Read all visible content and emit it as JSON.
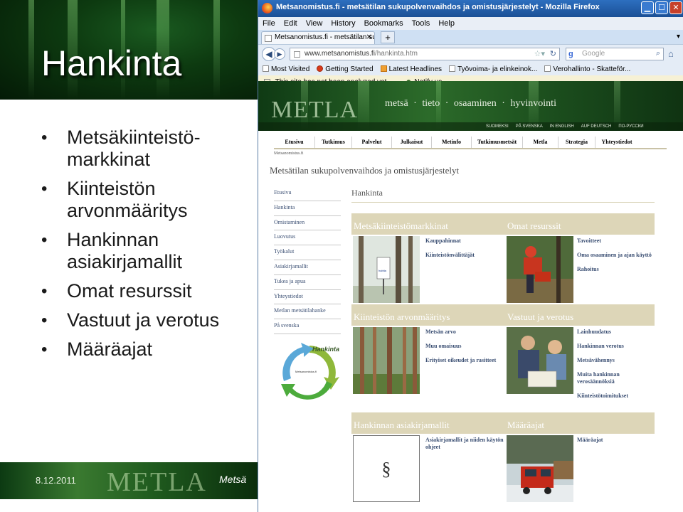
{
  "slide": {
    "title": "Hankinta",
    "bullets": [
      "Metsäkiinteistö-markkinat",
      "Kiinteistön arvonmääritys",
      "Hankinnan asiakirjamallit",
      "Omat resurssit",
      "Vastuut ja verotus",
      "Määräajat"
    ],
    "footer_date": "8.12.2011",
    "footer_logo": "METLA",
    "footer_word": "Metsä"
  },
  "browser": {
    "window_title": "Metsanomistus.fi - metsätilan sukupolvenvaihdos ja omistusjärjestelyt - Mozilla Firefox",
    "menu": [
      "File",
      "Edit",
      "View",
      "History",
      "Bookmarks",
      "Tools",
      "Help"
    ],
    "tab_title": "Metsanomistus.fi - metsätilan suku...",
    "url_host": "www.metsanomistus.fi",
    "url_path": "/hankinta.htm",
    "search_placeholder": "Google",
    "bookmarks": [
      "Most Visited",
      "Getting Started",
      "Latest Headlines",
      "Työvoima- ja elinkeinok...",
      "Verohallinto - Skatteför..."
    ],
    "notification": "This site has not been analyzed yet",
    "notify_us": "Notify us"
  },
  "site": {
    "logo": "METLA",
    "tagline": "metsä · tieto · osaaminen · hyvinvointi",
    "languages": [
      "SUOMEKSI",
      "PÅ SVENSKA",
      "IN ENGLISH",
      "AUF DEUTSCH",
      "ПО-РУССКИ"
    ],
    "top_nav": [
      "Etusivu",
      "Tutkimus",
      "Palvelut",
      "Julkaisut",
      "Metinfo",
      "Tutkimusmetsät",
      "Metla",
      "Strategia",
      "Yhteystiedot"
    ],
    "breadcrumb": "Metsanomistus.fi",
    "page_heading": "Metsätilan sukupolvenvaihdos ja omistusjärjestelyt",
    "left_nav": [
      "Etusivu",
      "Hankinta",
      "Omistaminen",
      "Luovutus",
      "Työkalut",
      "Asiakirjamallit",
      "Tukea ja apua",
      "Yhteystiedot",
      "Metlan metsätilahanke",
      "På svenska"
    ],
    "diagram_label": "Hankinta",
    "diagram_center": "Metsanomistus.fi",
    "main_heading": "Hankinta",
    "sections": [
      {
        "title": "Metsäkiinteistömarkkinat",
        "links": [
          "Kauppahinnat",
          "Kiinteistönvälittäjät"
        ]
      },
      {
        "title": "Omat resurssit",
        "links": [
          "Tavoitteet",
          "Oma osaaminen ja ajan käyttö",
          "Rahoitus"
        ]
      },
      {
        "title": "Kiinteistön arvonmääritys",
        "links": [
          "Metsän arvo",
          "Muu omaisuus",
          "Erityiset oikeudet ja rasitteet"
        ]
      },
      {
        "title": "Vastuut ja verotus",
        "links": [
          "Lainhuudatus",
          "Hankinnan verotus",
          "Metsävähennys",
          "Muita hankinnan verosäännöksiä",
          "Kiinteistötoimitukset"
        ]
      },
      {
        "title": "Hankinnan asiakirjamallit",
        "links": [
          "Asiakirjamallit ja niiden käytön ohjeet"
        ],
        "symbol": "§"
      },
      {
        "title": "Määräajat",
        "links": [
          "Määräajat"
        ]
      }
    ],
    "sign_text": "habita"
  },
  "colors": {
    "section_header": "#ddd6b8",
    "link": "#3b4f73",
    "forest_green": "#1f5a1e"
  }
}
